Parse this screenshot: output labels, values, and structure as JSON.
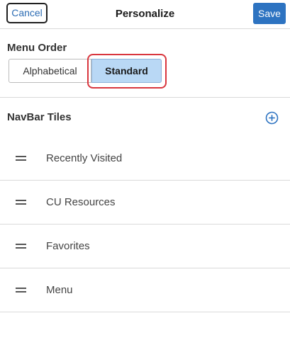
{
  "header": {
    "cancel_label": "Cancel",
    "title": "Personalize",
    "save_label": "Save"
  },
  "menu_order": {
    "label": "Menu Order",
    "options": [
      {
        "label": "Alphabetical",
        "selected": false
      },
      {
        "label": "Standard",
        "selected": true
      }
    ]
  },
  "navbar_tiles": {
    "label": "NavBar Tiles",
    "add_icon": "plus-circle-icon",
    "items": [
      {
        "label": "Recently Visited",
        "icon": "drag-handle-icon"
      },
      {
        "label": "CU Resources",
        "icon": "drag-handle-icon"
      },
      {
        "label": "Favorites",
        "icon": "drag-handle-icon"
      },
      {
        "label": "Menu",
        "icon": "drag-handle-icon"
      }
    ]
  },
  "colors": {
    "accent": "#2d73c1",
    "selected_bg": "#b9d8f5",
    "highlight": "#d9363e"
  }
}
